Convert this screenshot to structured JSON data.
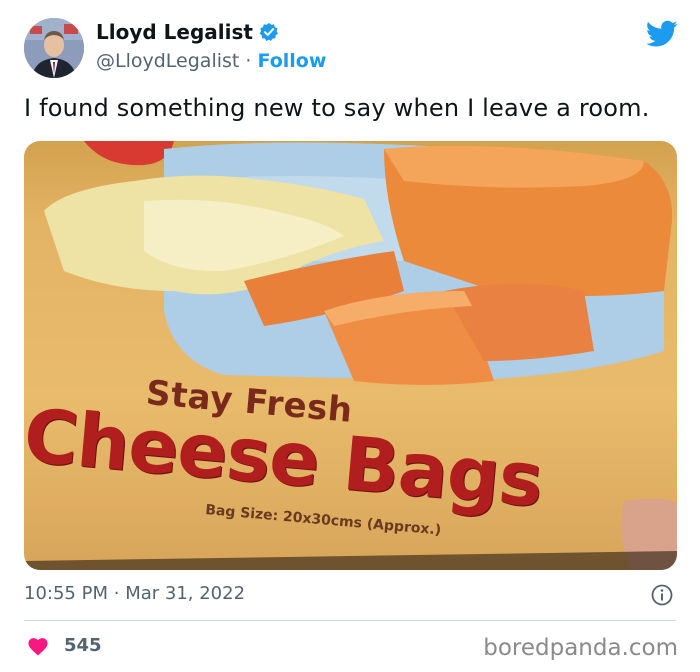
{
  "author": {
    "name": "Lloyd Legalist",
    "handle": "@LloydLegalist",
    "separator": "·",
    "follow_label": "Follow",
    "verified_icon": "verified-badge-icon",
    "avatar_icon": "avatar-image"
  },
  "brand_icon": "twitter-bird-icon",
  "tweet": {
    "text": "I found something new to say when I leave a room.",
    "time": "10:55 PM",
    "dot": "·",
    "date": "Mar 31, 2022",
    "info_icon": "info-icon"
  },
  "photo": {
    "line1": "Stay Fresh",
    "line2": "Cheese Bags",
    "line3": "Bag Size: 20x30cms (Approx.)"
  },
  "engagement": {
    "heart_icon": "heart-icon",
    "likes": "545"
  },
  "watermark": "boredpanda.com",
  "colors": {
    "accent": "#1d9bf0",
    "heart": "#f91880",
    "text": "#0f1419",
    "muted": "#536471",
    "cheese_red": "#b01e1e"
  }
}
